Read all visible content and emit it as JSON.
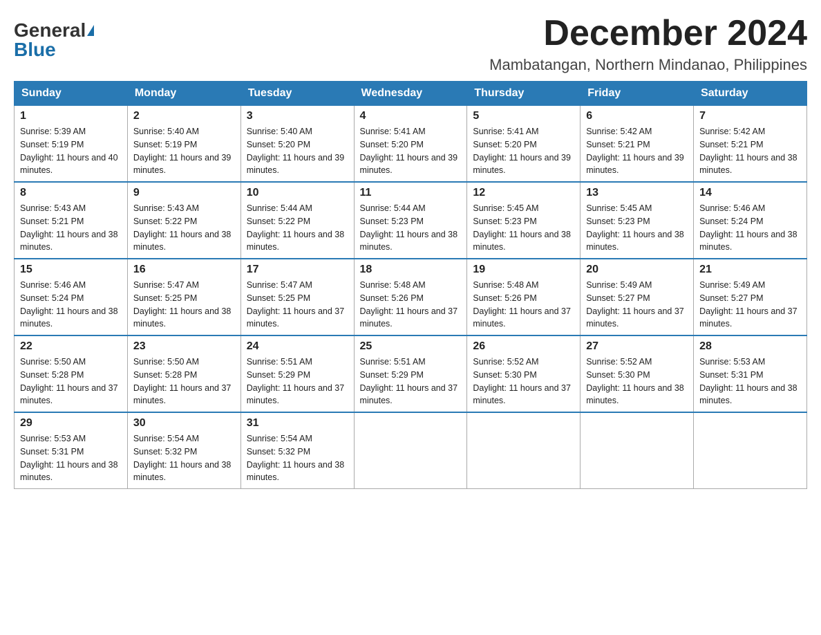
{
  "header": {
    "logo_general": "General",
    "logo_blue": "Blue",
    "month_title": "December 2024",
    "subtitle": "Mambatangan, Northern Mindanao, Philippines"
  },
  "weekdays": [
    "Sunday",
    "Monday",
    "Tuesday",
    "Wednesday",
    "Thursday",
    "Friday",
    "Saturday"
  ],
  "weeks": [
    [
      {
        "day": "1",
        "sunrise": "5:39 AM",
        "sunset": "5:19 PM",
        "daylight": "11 hours and 40 minutes."
      },
      {
        "day": "2",
        "sunrise": "5:40 AM",
        "sunset": "5:19 PM",
        "daylight": "11 hours and 39 minutes."
      },
      {
        "day": "3",
        "sunrise": "5:40 AM",
        "sunset": "5:20 PM",
        "daylight": "11 hours and 39 minutes."
      },
      {
        "day": "4",
        "sunrise": "5:41 AM",
        "sunset": "5:20 PM",
        "daylight": "11 hours and 39 minutes."
      },
      {
        "day": "5",
        "sunrise": "5:41 AM",
        "sunset": "5:20 PM",
        "daylight": "11 hours and 39 minutes."
      },
      {
        "day": "6",
        "sunrise": "5:42 AM",
        "sunset": "5:21 PM",
        "daylight": "11 hours and 39 minutes."
      },
      {
        "day": "7",
        "sunrise": "5:42 AM",
        "sunset": "5:21 PM",
        "daylight": "11 hours and 38 minutes."
      }
    ],
    [
      {
        "day": "8",
        "sunrise": "5:43 AM",
        "sunset": "5:21 PM",
        "daylight": "11 hours and 38 minutes."
      },
      {
        "day": "9",
        "sunrise": "5:43 AM",
        "sunset": "5:22 PM",
        "daylight": "11 hours and 38 minutes."
      },
      {
        "day": "10",
        "sunrise": "5:44 AM",
        "sunset": "5:22 PM",
        "daylight": "11 hours and 38 minutes."
      },
      {
        "day": "11",
        "sunrise": "5:44 AM",
        "sunset": "5:23 PM",
        "daylight": "11 hours and 38 minutes."
      },
      {
        "day": "12",
        "sunrise": "5:45 AM",
        "sunset": "5:23 PM",
        "daylight": "11 hours and 38 minutes."
      },
      {
        "day": "13",
        "sunrise": "5:45 AM",
        "sunset": "5:23 PM",
        "daylight": "11 hours and 38 minutes."
      },
      {
        "day": "14",
        "sunrise": "5:46 AM",
        "sunset": "5:24 PM",
        "daylight": "11 hours and 38 minutes."
      }
    ],
    [
      {
        "day": "15",
        "sunrise": "5:46 AM",
        "sunset": "5:24 PM",
        "daylight": "11 hours and 38 minutes."
      },
      {
        "day": "16",
        "sunrise": "5:47 AM",
        "sunset": "5:25 PM",
        "daylight": "11 hours and 38 minutes."
      },
      {
        "day": "17",
        "sunrise": "5:47 AM",
        "sunset": "5:25 PM",
        "daylight": "11 hours and 37 minutes."
      },
      {
        "day": "18",
        "sunrise": "5:48 AM",
        "sunset": "5:26 PM",
        "daylight": "11 hours and 37 minutes."
      },
      {
        "day": "19",
        "sunrise": "5:48 AM",
        "sunset": "5:26 PM",
        "daylight": "11 hours and 37 minutes."
      },
      {
        "day": "20",
        "sunrise": "5:49 AM",
        "sunset": "5:27 PM",
        "daylight": "11 hours and 37 minutes."
      },
      {
        "day": "21",
        "sunrise": "5:49 AM",
        "sunset": "5:27 PM",
        "daylight": "11 hours and 37 minutes."
      }
    ],
    [
      {
        "day": "22",
        "sunrise": "5:50 AM",
        "sunset": "5:28 PM",
        "daylight": "11 hours and 37 minutes."
      },
      {
        "day": "23",
        "sunrise": "5:50 AM",
        "sunset": "5:28 PM",
        "daylight": "11 hours and 37 minutes."
      },
      {
        "day": "24",
        "sunrise": "5:51 AM",
        "sunset": "5:29 PM",
        "daylight": "11 hours and 37 minutes."
      },
      {
        "day": "25",
        "sunrise": "5:51 AM",
        "sunset": "5:29 PM",
        "daylight": "11 hours and 37 minutes."
      },
      {
        "day": "26",
        "sunrise": "5:52 AM",
        "sunset": "5:30 PM",
        "daylight": "11 hours and 37 minutes."
      },
      {
        "day": "27",
        "sunrise": "5:52 AM",
        "sunset": "5:30 PM",
        "daylight": "11 hours and 38 minutes."
      },
      {
        "day": "28",
        "sunrise": "5:53 AM",
        "sunset": "5:31 PM",
        "daylight": "11 hours and 38 minutes."
      }
    ],
    [
      {
        "day": "29",
        "sunrise": "5:53 AM",
        "sunset": "5:31 PM",
        "daylight": "11 hours and 38 minutes."
      },
      {
        "day": "30",
        "sunrise": "5:54 AM",
        "sunset": "5:32 PM",
        "daylight": "11 hours and 38 minutes."
      },
      {
        "day": "31",
        "sunrise": "5:54 AM",
        "sunset": "5:32 PM",
        "daylight": "11 hours and 38 minutes."
      },
      null,
      null,
      null,
      null
    ]
  ]
}
